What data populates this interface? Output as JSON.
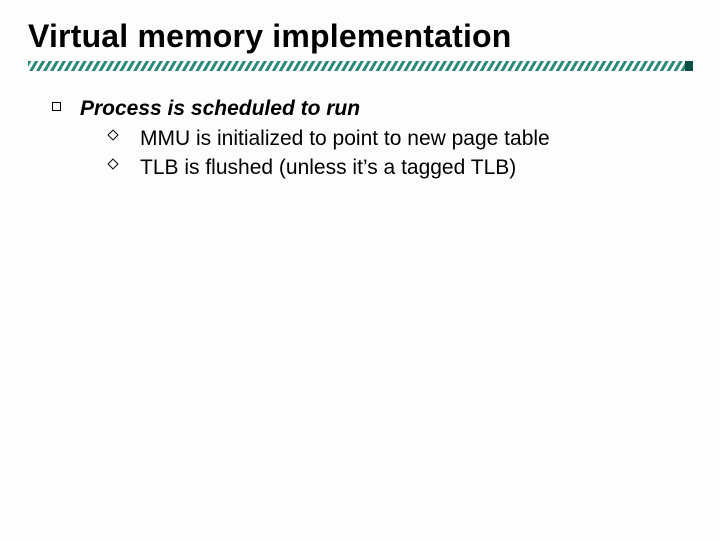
{
  "title": "Virtual memory implementation",
  "bullets": {
    "heading": "Process is scheduled to run",
    "sub1": "MMU is initialized to point to new page table",
    "sub2": "TLB is flushed (unless it’s a tagged TLB)"
  }
}
